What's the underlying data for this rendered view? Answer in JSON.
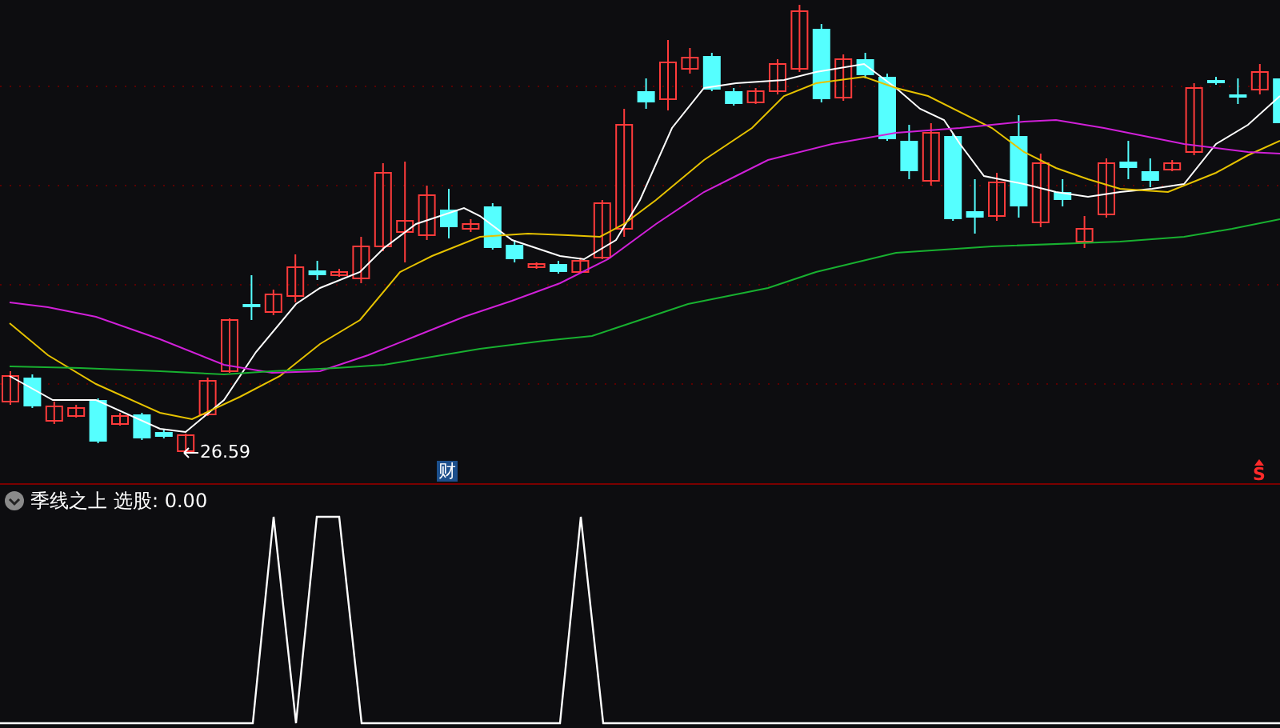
{
  "price_chart": {
    "low_label": "26.59",
    "finance_marker": "财",
    "signal_marker": "S"
  },
  "indicator": {
    "title": "季线之上",
    "reading": "选股: 0.00"
  }
}
